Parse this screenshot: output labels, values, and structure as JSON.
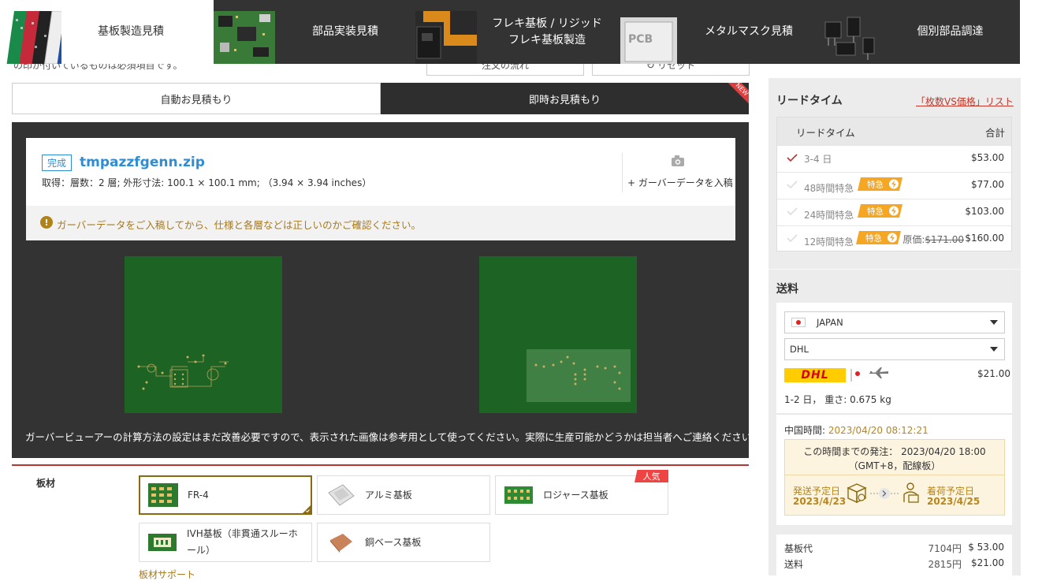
{
  "nav": {
    "tabs": [
      {
        "label": "基板製造見積"
      },
      {
        "label": "部品実装見積"
      },
      {
        "label_line1": "フレキ基板 / リジッド",
        "label_line2": "フレキ基板製造"
      },
      {
        "label": "メタルマスク見積"
      },
      {
        "label": "個別部品調達"
      }
    ]
  },
  "header": {
    "required_note": "の印が付いているものは必須項目です。",
    "flow_button": "注文の流れ",
    "reset_button": "リセット"
  },
  "mode_tabs": {
    "auto": "自動お見積もり",
    "instant": "即時お見積もり",
    "new_badge": "NEW"
  },
  "viewer": {
    "status_badge": "完成",
    "filename": "tmpazzfgenn.zip",
    "info": "取得：層数：2 層; 外形寸法: 100.1 × 100.1 mm; （3.94 × 3.94 inches）",
    "upload_label": "+ ガーバーデータを入稿",
    "warning": "ガーバーデータをご入稿してから、仕様と各層などは正しいのかご確認ください。",
    "note": "ガーバービューアーの計算方法の設定はまだ改善必要ですので、表示された画像は参考用として使ってください。実際に生産可能かどうかは担当者へご連絡ください。"
  },
  "material": {
    "label": "板材",
    "options": [
      "FR-4",
      "アルミ基板",
      "ロジャース基板",
      "IVH基板（非貫通スルーホール）",
      "銅ベース基板"
    ],
    "option_ivh_line1": "IVH基板（非貫通スルーホ",
    "option_ivh_line2": "ール）",
    "popular_badge": "人気",
    "selected": "FR-4",
    "link": "板材サポート"
  },
  "lead_time": {
    "title": "リードタイム",
    "price_list_link": "「枚数VS価格」リスト",
    "col_time": "リードタイム",
    "col_total": "合計",
    "badge": "特急",
    "rows": [
      {
        "label": "3-4 日",
        "price": "$53.00",
        "original": "",
        "selected": true
      },
      {
        "label": "48時間特急",
        "price": "$77.00",
        "original": "",
        "selected": false
      },
      {
        "label": "24時間特急",
        "price": "$103.00",
        "original": "",
        "selected": false
      },
      {
        "label": "12時間特急",
        "price": "$160.00",
        "original_label": "原価:",
        "original": "$171.00",
        "selected": false
      }
    ]
  },
  "shipping": {
    "title": "送料",
    "country": "JAPAN",
    "carrier": "DHL",
    "carrier_logo": "DHL",
    "price": "$21.00",
    "days": "1-2 日， 重さ: 0.675 kg"
  },
  "schedule": {
    "cn_time_label": "中国時間:",
    "cn_time": "2023/04/20 08:12:21",
    "cutoff_line1": "この時間までの発注： 2023/04/20 18:00",
    "cutoff_line2": "（GMT+8，配線板）",
    "send_label": "発送予定日",
    "send_date": "2023/4/23",
    "arrive_label": "着荷予定日",
    "arrive_date": "2023/4/25"
  },
  "costs": [
    {
      "label": "基板代",
      "yen": "7104円",
      "usd": "$ 53.00"
    },
    {
      "label": "送料",
      "yen": "2815円",
      "usd": "$21.00"
    }
  ],
  "colors": {
    "accent_gold": "#a7791b",
    "link_blue": "#2d8ed6",
    "dark_panel": "#333333",
    "board_green": "#1d6324",
    "badge_orange": "#f5a623",
    "danger_red": "#e23b3b"
  }
}
